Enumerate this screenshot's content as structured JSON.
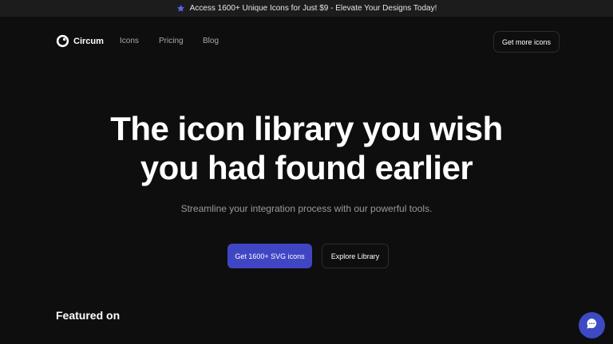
{
  "announcement": {
    "icon": "star-icon",
    "text": "Access 1600+ Unique Icons for Just $9 - Elevate Your Designs Today!"
  },
  "nav": {
    "logo_text": "Circum",
    "links": [
      "Icons",
      "Pricing",
      "Blog"
    ],
    "cta_label": "Get more icons"
  },
  "hero": {
    "title_line1": "The icon library you wish",
    "title_line2": "you had found earlier",
    "subtitle": "Streamline your integration process with our powerful tools.",
    "primary_label": "Get 1600+ SVG icons",
    "secondary_label": "Explore Library"
  },
  "featured": {
    "heading": "Featured on"
  },
  "chat": {
    "icon": "chat-bubble-icon"
  },
  "colors": {
    "background": "#0e0e0e",
    "accent": "#4046c3",
    "star": "#5b63e0"
  }
}
